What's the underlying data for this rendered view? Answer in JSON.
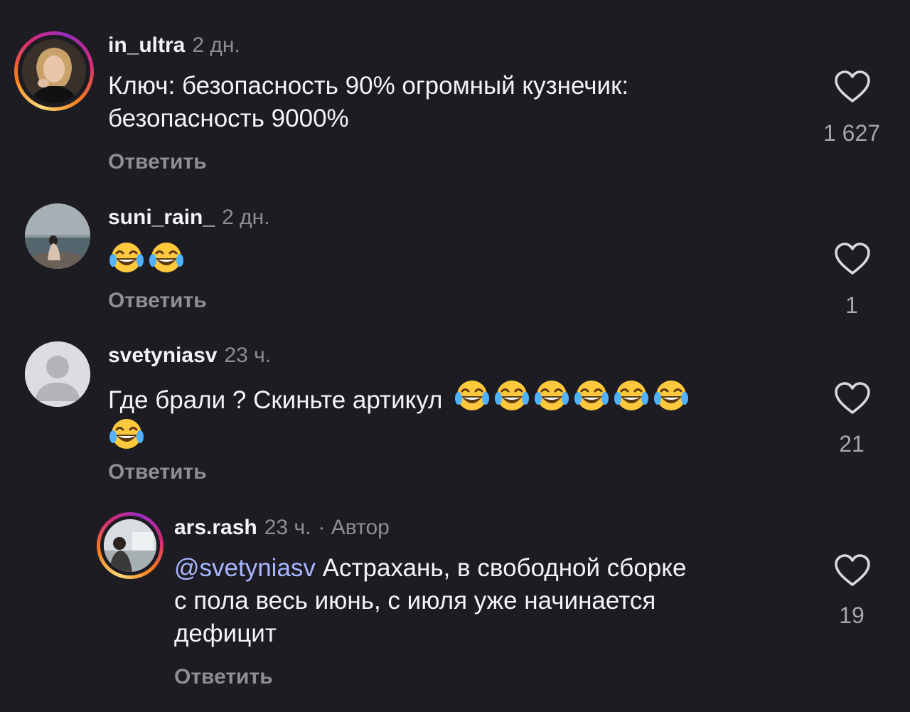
{
  "comments": [
    {
      "username": "in_ultra",
      "time": "2 дн.",
      "author_tag": "",
      "text": "Ключ: безопасность 90% огромный кузнечик: безопасность 9000%",
      "reply_label": "Ответить",
      "likes": "1 627",
      "has_story_ring": true,
      "avatar_icon": "avatar-woman-photo"
    },
    {
      "username": "suni_rain_",
      "time": "2 дн.",
      "author_tag": "",
      "text": "",
      "emoji_count": 2,
      "emoji_name": "face-with-tears-of-joy",
      "reply_label": "Ответить",
      "likes": "1",
      "has_story_ring": false,
      "avatar_icon": "avatar-sea-photo"
    },
    {
      "username": "svetyniasv",
      "time": "23 ч.",
      "author_tag": "",
      "text": "Где брали ? Скиньте артикул",
      "emoji_count": 7,
      "emoji_name": "face-with-tears-of-joy",
      "reply_label": "Ответить",
      "likes": "21",
      "has_story_ring": false,
      "avatar_icon": "default-user-icon"
    },
    {
      "username": "ars.rash",
      "time": "23 ч.",
      "author_tag": "· Автор",
      "mention": "@svetyniasv",
      "text_line1": "Астрахань, в свободной сборке",
      "text_line2": "с пола весь июнь, с июля уже начинается",
      "text_line3": "дефицит",
      "reply_label": "Ответить",
      "likes": "19",
      "has_story_ring": true,
      "avatar_icon": "avatar-man-photo"
    }
  ],
  "colors": {
    "background": "#1c1c22",
    "muted_text": "#8e8e96",
    "mention": "#a9b6ff"
  },
  "icons": {
    "like": "heart-outline-icon"
  }
}
